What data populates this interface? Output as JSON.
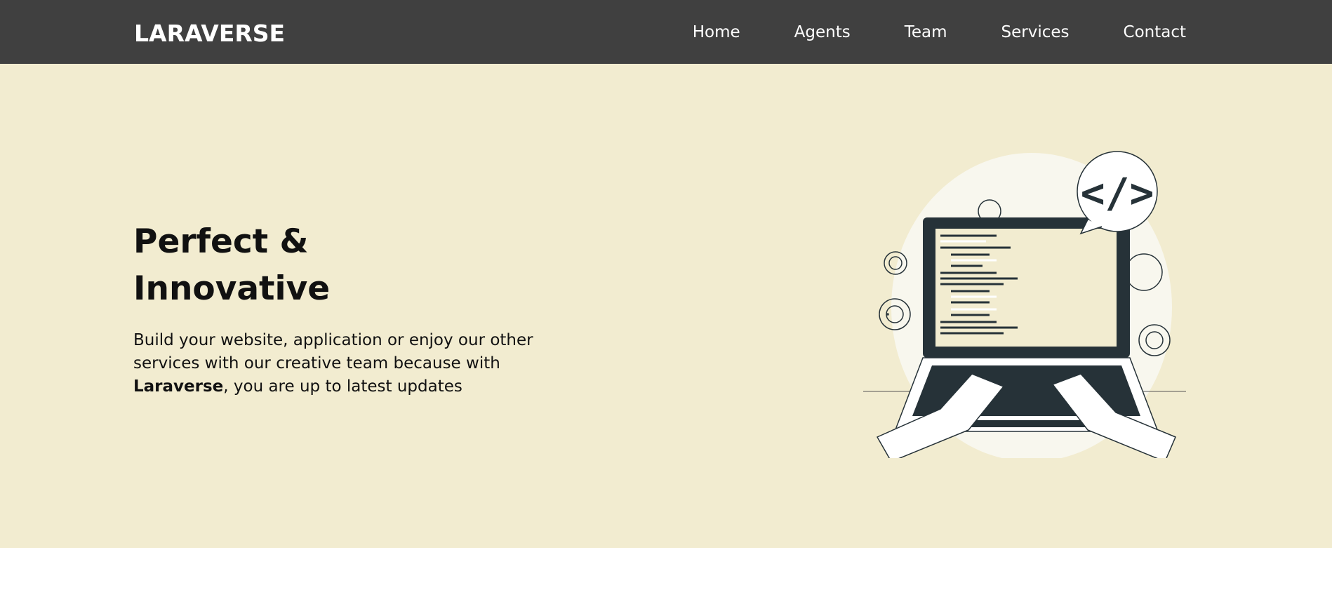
{
  "header": {
    "logo": "LARAVERSE",
    "nav": [
      {
        "label": "Home"
      },
      {
        "label": "Agents"
      },
      {
        "label": "Team"
      },
      {
        "label": "Services"
      },
      {
        "label": "Contact"
      }
    ]
  },
  "hero": {
    "title_line1": "Perfect &",
    "title_line2": "Innovative",
    "desc_before": "Build your website, application or enjoy our other services with our creative team because with ",
    "desc_bold": "Laraverse",
    "desc_after": ", you are up to latest updates",
    "illustration_icon": "code-bubble-icon"
  },
  "colors": {
    "nav_bg": "#404040",
    "hero_bg": "#f2ecd0",
    "ink": "#263238"
  }
}
